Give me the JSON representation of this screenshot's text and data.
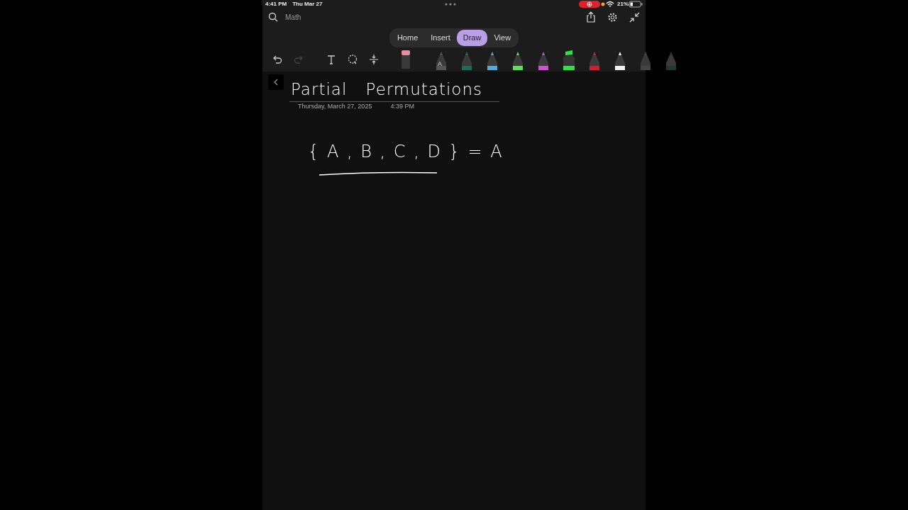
{
  "status_bar": {
    "time": "4:41 PM",
    "date": "Thu Mar 27",
    "recording": true,
    "battery": "21%"
  },
  "search": {
    "placeholder": "Math"
  },
  "tabs": [
    {
      "label": "Home",
      "selected": false
    },
    {
      "label": "Insert",
      "selected": false
    },
    {
      "label": "Draw",
      "selected": true
    },
    {
      "label": "View",
      "selected": false
    }
  ],
  "tools": [
    {
      "kind": "undo",
      "disabled": false
    },
    {
      "kind": "redo",
      "disabled": true
    },
    {
      "kind": "text",
      "disabled": false
    },
    {
      "kind": "lasso",
      "disabled": false
    },
    {
      "kind": "space",
      "disabled": false
    },
    {
      "kind": "eraser",
      "disabled": false
    }
  ],
  "pens": [
    {
      "color": "#555555",
      "label": "A"
    },
    {
      "color": "#1f6b5a"
    },
    {
      "color": "#5aa7e0"
    },
    {
      "color": "#5fe05a"
    },
    {
      "color": "#d050d8"
    },
    {
      "color": "#32e040",
      "kind": "highlighter"
    },
    {
      "color": "#d02030"
    },
    {
      "color": "#f0f0f0"
    },
    {
      "color": "#444444"
    },
    {
      "color": "#1e3a28"
    }
  ],
  "page": {
    "title": "Partial Permutations",
    "date": "Thursday, March 27, 2025",
    "time": "4:39 PM",
    "ink": [
      "{ A , B , C , D } = A"
    ]
  }
}
